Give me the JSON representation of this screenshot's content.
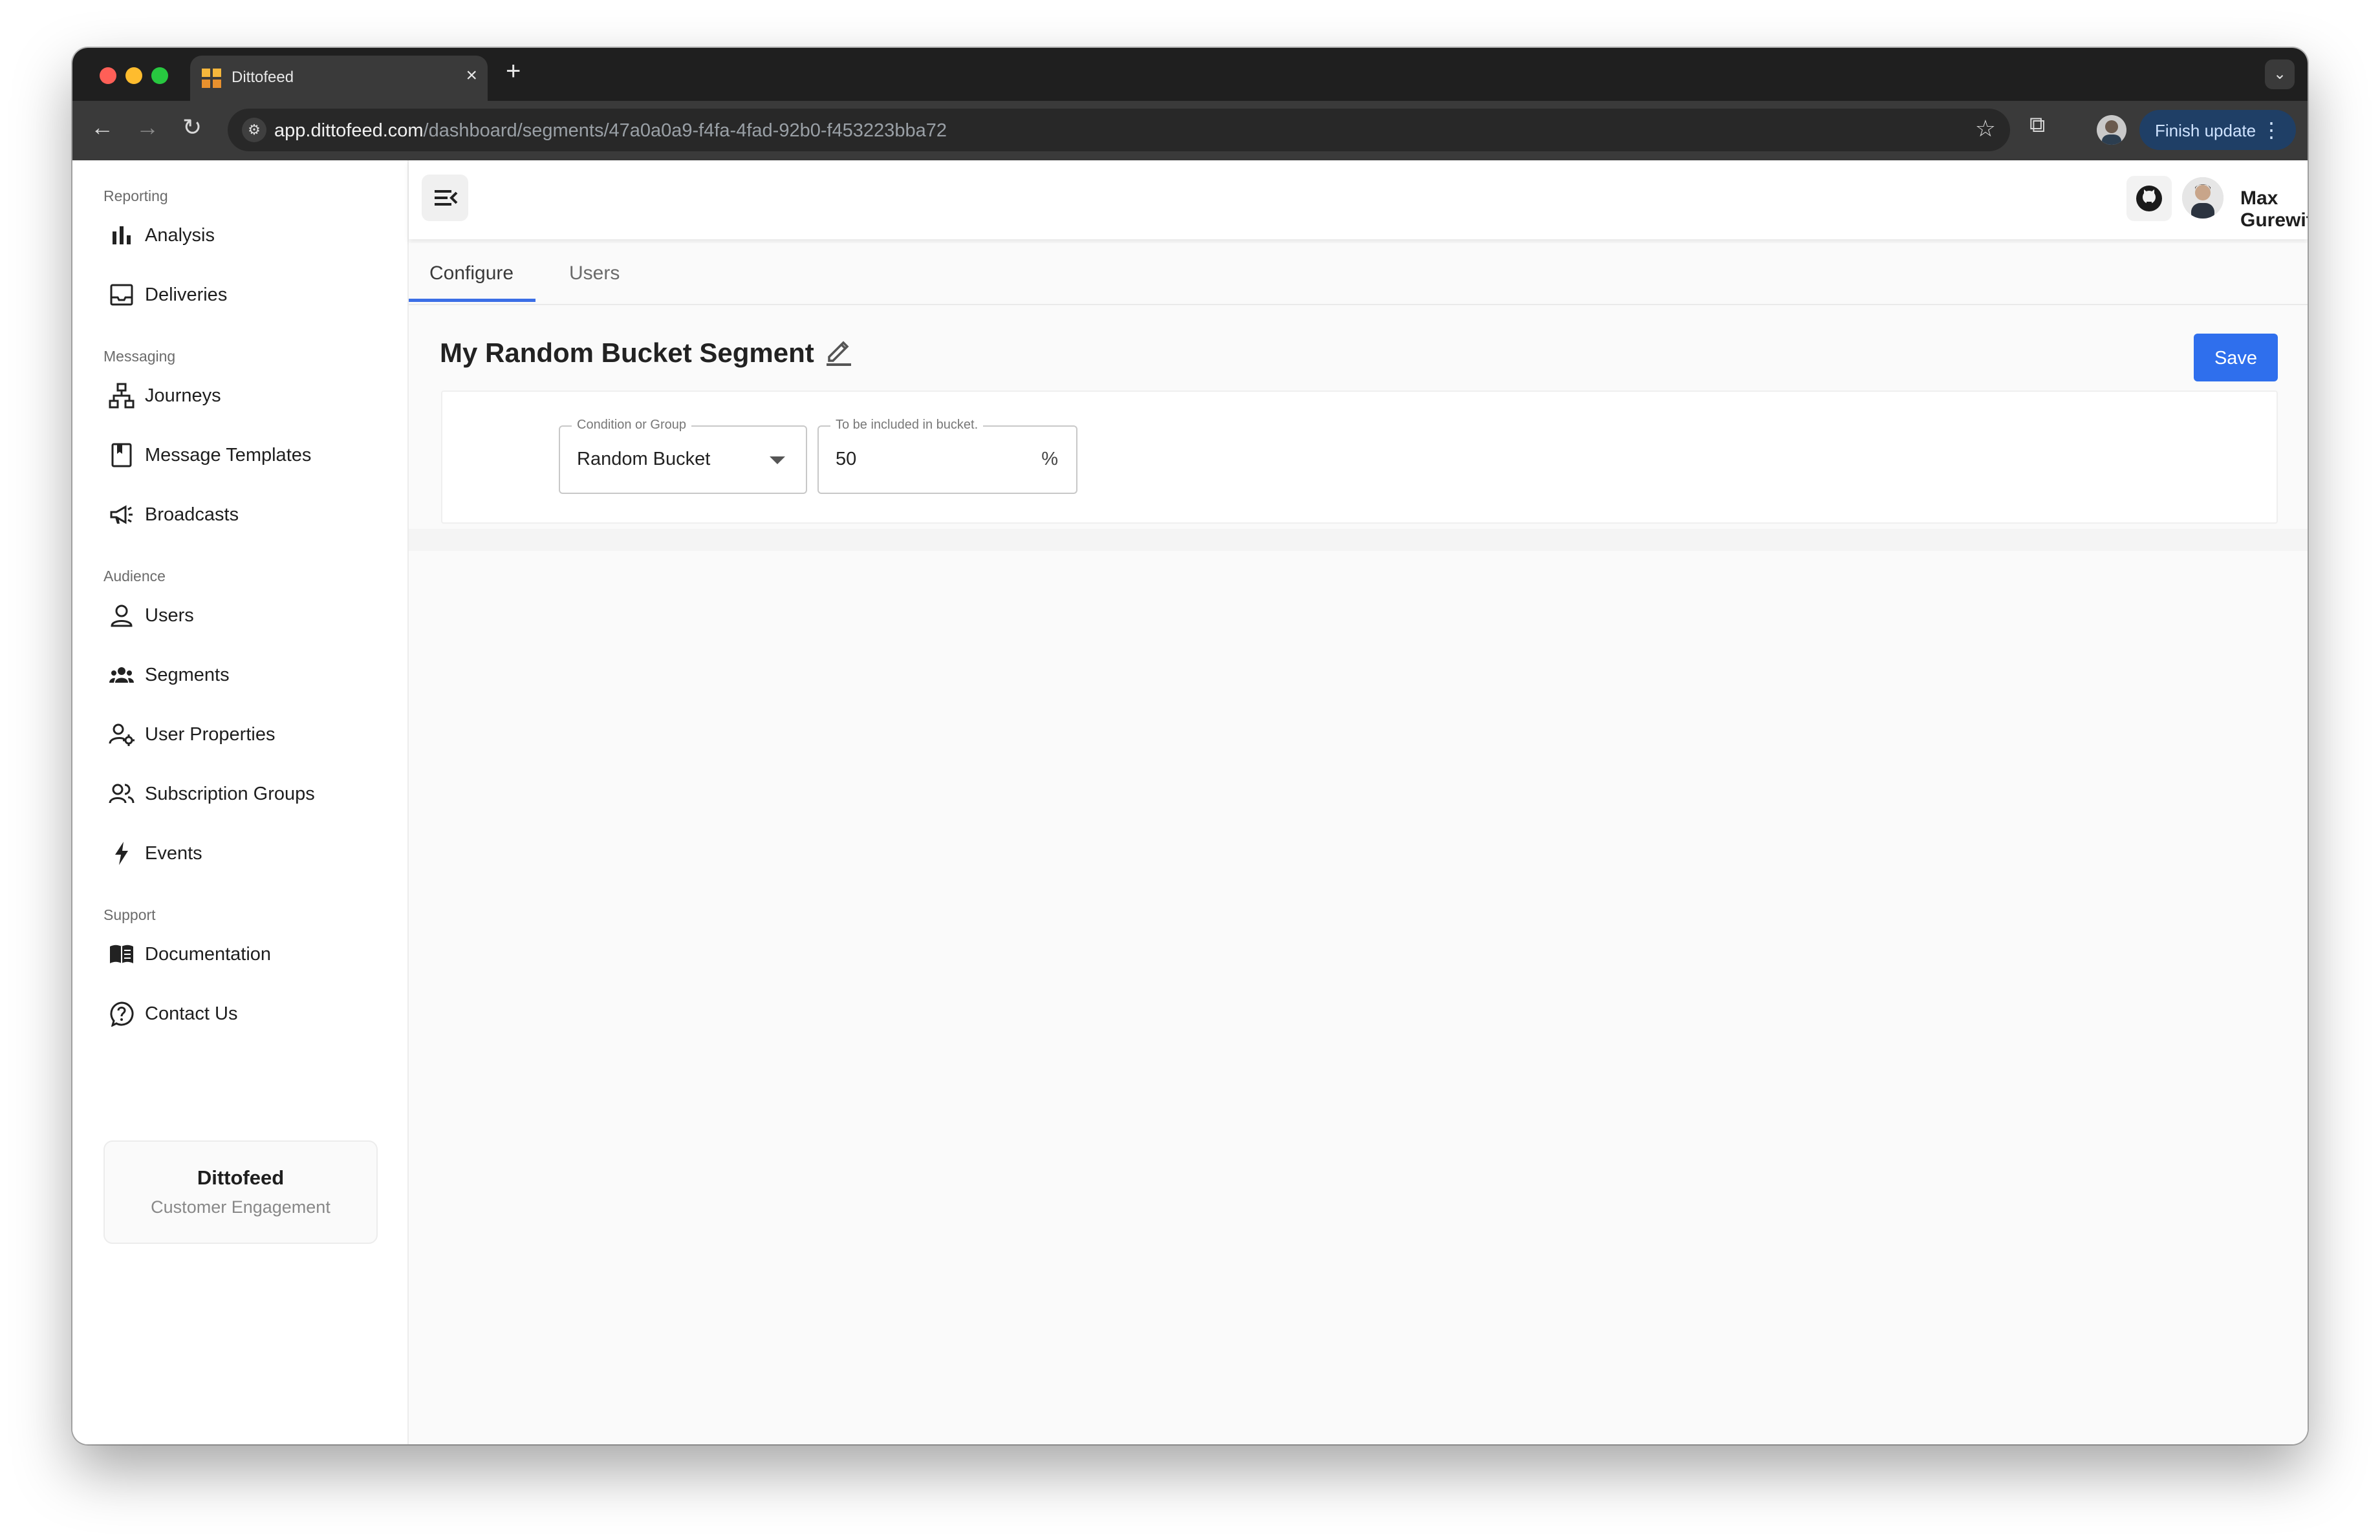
{
  "browser": {
    "tab_title": "Dittofeed",
    "url_host": "app.dittofeed.com",
    "url_path": "/dashboard/segments/47a0a0a9-f4fa-4fad-92b0-f453223bba72",
    "finish_update_label": "Finish update"
  },
  "sidebar": {
    "groups": [
      {
        "label": "Reporting",
        "items": [
          {
            "label": "Analysis",
            "icon": "bar-chart-icon"
          },
          {
            "label": "Deliveries",
            "icon": "inbox-icon"
          }
        ]
      },
      {
        "label": "Messaging",
        "items": [
          {
            "label": "Journeys",
            "icon": "journey-tree-icon"
          },
          {
            "label": "Message Templates",
            "icon": "bookmark-book-icon"
          },
          {
            "label": "Broadcasts",
            "icon": "megaphone-icon"
          }
        ]
      },
      {
        "label": "Audience",
        "items": [
          {
            "label": "Users",
            "icon": "user-icon"
          },
          {
            "label": "Segments",
            "icon": "group-icon"
          },
          {
            "label": "User Properties",
            "icon": "user-gear-icon"
          },
          {
            "label": "Subscription Groups",
            "icon": "users-icon"
          },
          {
            "label": "Events",
            "icon": "bolt-icon"
          }
        ]
      },
      {
        "label": "Support",
        "items": [
          {
            "label": "Documentation",
            "icon": "open-book-icon"
          },
          {
            "label": "Contact Us",
            "icon": "question-bubble-icon"
          }
        ]
      }
    ],
    "brand": {
      "name": "Dittofeed",
      "subtitle": "Customer Engagement"
    }
  },
  "header": {
    "user_name": "Max Gurewitz"
  },
  "tabs": [
    {
      "label": "Configure",
      "active": true
    },
    {
      "label": "Users",
      "active": false
    }
  ],
  "segment": {
    "title": "My Random Bucket Segment",
    "save_label": "Save",
    "condition": {
      "legend": "Condition or Group",
      "value": "Random Bucket"
    },
    "bucket": {
      "legend": "To be included in bucket.",
      "value": "50",
      "suffix": "%"
    }
  },
  "colors": {
    "accent": "#2f6fed",
    "browser_chrome": "#1f1f1f"
  }
}
